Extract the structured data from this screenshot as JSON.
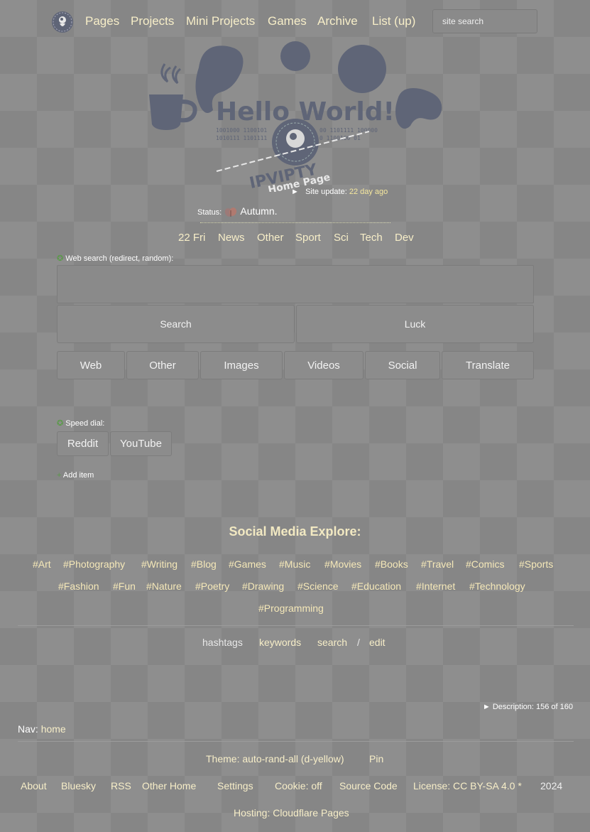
{
  "nav": {
    "links": [
      "Pages",
      "Projects",
      "Mini Projects",
      "Games",
      "Archive",
      "List (up)"
    ],
    "search_placeholder": "site search"
  },
  "header": {
    "hello": "Hello World!",
    "brand": "IPVIPTY",
    "home_page": "Home Page",
    "binary_left_1": "1001000 1100101",
    "binary_left_2": "1010111 1101111",
    "binary_right_1": "00 1101111 100000",
    "binary_right_2": "0 1100100 01"
  },
  "site_update": {
    "arrow": "►",
    "label": "Site update:",
    "value": "22 day ago"
  },
  "status": {
    "label": "Status:",
    "value": "Autumn."
  },
  "quick_links": [
    "22 Fri",
    "News",
    "Other",
    "Sport",
    "Sci",
    "Tech",
    "Dev"
  ],
  "web_search": {
    "label": "Web search (redirect, random):",
    "bullet": "✪",
    "search_button": "Search",
    "luck_button": "Luck",
    "engines": [
      "Web",
      "Other",
      "Images",
      "Videos",
      "Social",
      "Translate"
    ]
  },
  "speed_dial": {
    "label": "Speed dial:",
    "bullet": "✪",
    "items": [
      "Reddit",
      "YouTube"
    ],
    "add_plus": "+",
    "add_label": "Add item"
  },
  "social": {
    "title": "Social Media Explore:",
    "tags": [
      "#Art",
      "#Photography",
      "#Writing",
      "#Blog",
      "#Games",
      "#Music",
      "#Movies",
      "#Books",
      "#Travel",
      "#Comics",
      "#Sports",
      "#Fashion",
      "#Fun",
      "#Nature",
      "#Poetry",
      "#Drawing",
      "#Science",
      "#Education",
      "#Internet",
      "#Technology",
      "#Programming"
    ],
    "sub": {
      "hashtags": "hashtags",
      "keywords": "keywords",
      "search": "search",
      "slash": "/",
      "edit": "edit"
    }
  },
  "description": {
    "arrow": "►",
    "text": "Description: 156 of 160"
  },
  "navline": {
    "label": "Nav:",
    "link": "home"
  },
  "footer": {
    "theme": "Theme: auto-rand-all (d-yellow)",
    "pin": "Pin",
    "links": [
      "About",
      "Bluesky",
      "RSS",
      "Other Home",
      "Settings",
      "Cookie: off",
      "Source Code",
      "License: CC BY-SA 4.0 *"
    ],
    "year": "2024",
    "hosting": "Hosting: Cloudflare Pages"
  },
  "colors": {
    "accent": "#f7eec8",
    "blob": "#5f6577",
    "bg": "#8e8e8e",
    "green": "#5a9a48"
  }
}
